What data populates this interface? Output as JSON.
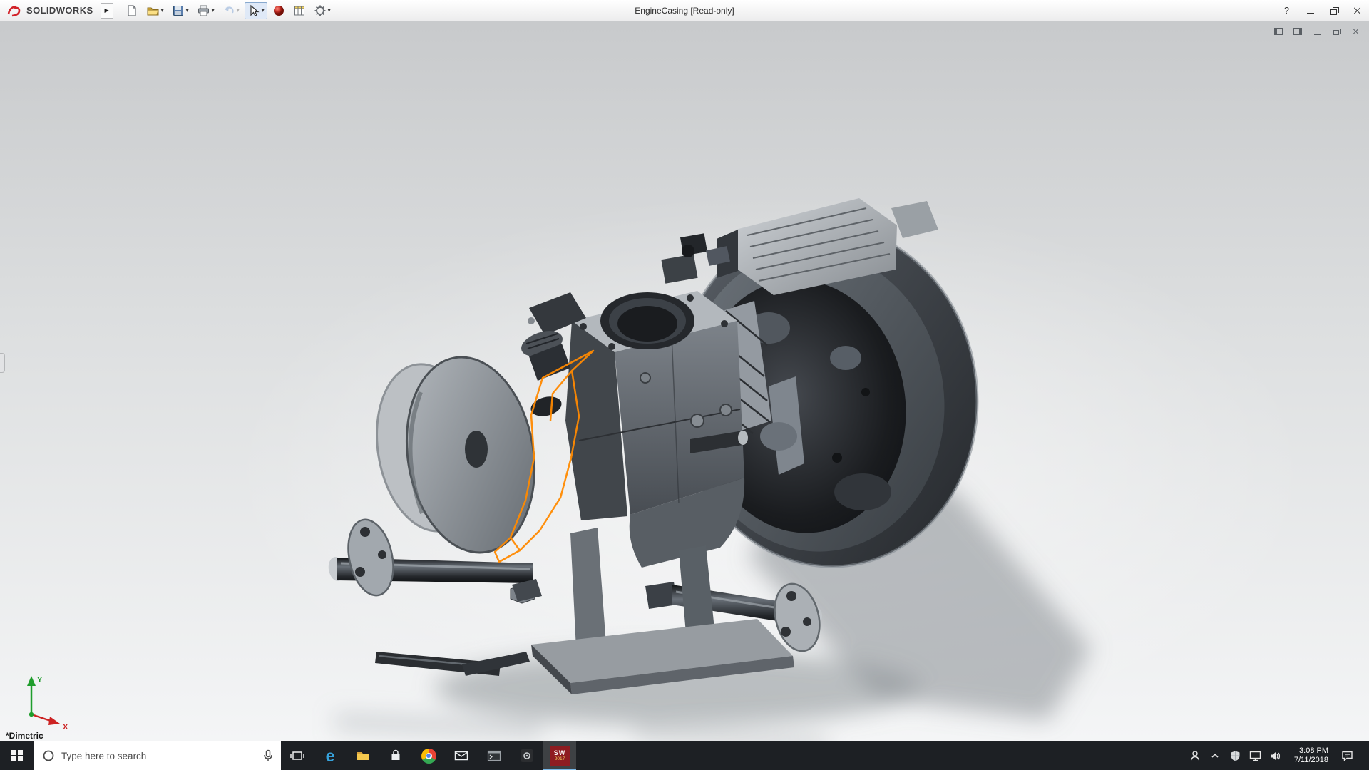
{
  "window": {
    "title": "EngineCasing [Read-only]",
    "brand": "SOLIDWORKS",
    "help_glyph": "?",
    "controls": [
      "help",
      "minimize",
      "restore",
      "close"
    ]
  },
  "toolbar": {
    "flyout_glyph": "▶",
    "caret_glyph": "▾",
    "items": [
      {
        "icon": "new-document-icon",
        "has_dropdown": false,
        "disabled": false,
        "active": false
      },
      {
        "icon": "open-icon",
        "has_dropdown": true,
        "disabled": false,
        "active": false
      },
      {
        "icon": "save-icon",
        "has_dropdown": true,
        "disabled": false,
        "active": false
      },
      {
        "icon": "print-icon",
        "has_dropdown": true,
        "disabled": false,
        "active": false
      },
      {
        "icon": "undo-icon",
        "has_dropdown": true,
        "disabled": true,
        "active": false
      },
      {
        "icon": "select-cursor-icon",
        "has_dropdown": true,
        "disabled": false,
        "active": true
      },
      {
        "icon": "appearance-sphere-icon",
        "has_dropdown": false,
        "disabled": false,
        "active": false
      },
      {
        "icon": "design-table-icon",
        "has_dropdown": false,
        "disabled": false,
        "active": false
      },
      {
        "icon": "options-gear-icon",
        "has_dropdown": true,
        "disabled": false,
        "active": false
      }
    ]
  },
  "document_controls": [
    "pane-left",
    "pane-right",
    "minimize",
    "restore",
    "close"
  ],
  "viewport": {
    "orientation_label": "*Dimetric",
    "triad": {
      "x_label": "X",
      "y_label": "Y"
    },
    "model": "engine-casing-3d-model",
    "highlight": "orange-selected-sketch-contour"
  },
  "taskbar": {
    "search": {
      "placeholder": "Type here to search",
      "icons": [
        "cortana-circle-icon",
        "microphone-icon"
      ]
    },
    "apps": [
      {
        "name": "start"
      },
      {
        "name": "task-view"
      },
      {
        "name": "edge",
        "glyph": "e"
      },
      {
        "name": "file-explorer"
      },
      {
        "name": "store"
      },
      {
        "name": "chrome"
      },
      {
        "name": "mail"
      },
      {
        "name": "console"
      },
      {
        "name": "settings"
      },
      {
        "name": "solidworks-2017",
        "label": "SW",
        "sublabel": "2017",
        "active": true
      }
    ],
    "tray": {
      "icons": [
        "people-icon",
        "chevron-up-icon",
        "defender-shield-icon",
        "network-display-icon",
        "volume-icon",
        "action-center-icon"
      ],
      "time": "3:08 PM",
      "date": "7/11/2018"
    }
  },
  "colors": {
    "accent_orange": "#ff8a00",
    "brand_red": "#d2232a",
    "taskbar_bg": "#1d2024",
    "titlebar_bg": "#f2f2f3",
    "model_metal_dark": "#2b2e32",
    "model_metal_light": "#a8adb2"
  }
}
